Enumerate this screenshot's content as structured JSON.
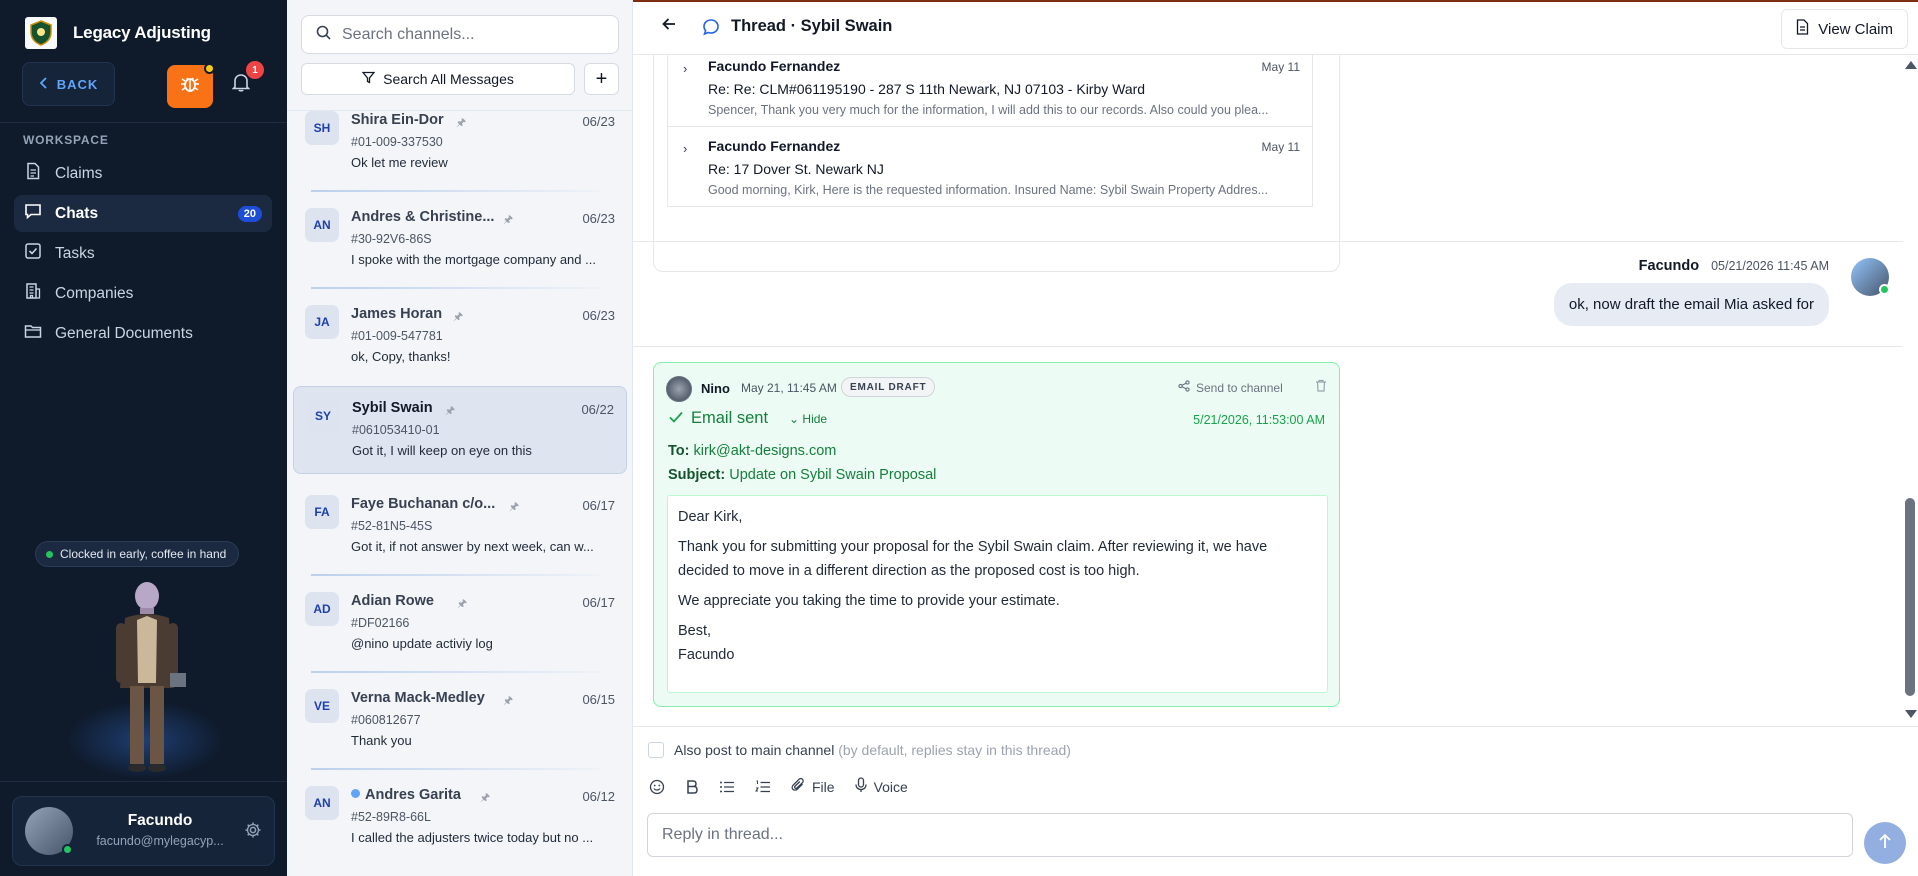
{
  "app": {
    "title": "Legacy Adjusting"
  },
  "sidebar": {
    "back_label": "BACK",
    "notification_count": "1",
    "section_label": "WORKSPACE",
    "items": [
      {
        "label": "Claims",
        "icon": "document-icon"
      },
      {
        "label": "Chats",
        "icon": "chat-icon",
        "badge": "20",
        "active": true
      },
      {
        "label": "Tasks",
        "icon": "checkbox-icon"
      },
      {
        "label": "Companies",
        "icon": "building-icon"
      },
      {
        "label": "General Documents",
        "icon": "folder-icon"
      }
    ],
    "status_text": "Clocked in early, coffee in hand",
    "user": {
      "name": "Facundo",
      "email": "facundo@mylegacyp..."
    }
  },
  "channels": {
    "search_placeholder": "Search channels...",
    "search_all_label": "Search All Messages",
    "add_label": "+",
    "list": [
      {
        "initials": "SH",
        "name": "Shira Ein-Dor",
        "date": "06/23",
        "code": "#01-009-337530",
        "last": "Ok let me review"
      },
      {
        "initials": "AN",
        "name": "Andres & Christine...",
        "date": "06/23",
        "code": "#30-92V6-86S",
        "last": "I spoke with the mortgage company and ..."
      },
      {
        "initials": "JA",
        "name": "James Horan",
        "date": "06/23",
        "code": "#01-009-547781",
        "last": "ok, Copy, thanks!"
      },
      {
        "initials": "SY",
        "name": "Sybil Swain",
        "date": "06/22",
        "code": "#061053410-01",
        "last": "Got it, I will keep on eye on this",
        "selected": true
      },
      {
        "initials": "FA",
        "name": "Faye Buchanan c/o...",
        "date": "06/17",
        "code": "#52-81N5-45S",
        "last": "Got it, if not answer by next week, can w..."
      },
      {
        "initials": "AD",
        "name": "Adian Rowe",
        "date": "06/17",
        "code": "#DF02166",
        "last": "@nino update activiy log"
      },
      {
        "initials": "VE",
        "name": "Verna Mack-Medley",
        "date": "06/15",
        "code": "#060812677",
        "last": "Thank you"
      },
      {
        "initials": "AN",
        "name": "Andres Garita",
        "date": "06/12",
        "code": "#52-89R8-66L",
        "last": "I called the adjusters twice today but no ...",
        "unread": true
      }
    ]
  },
  "thread": {
    "title": "Thread · Sybil Swain",
    "view_claim_label": "View Claim",
    "emails": [
      {
        "from": "Facundo Fernandez",
        "date": "May 11",
        "subject": "Re: Re: CLM#061195190 - 287 S 11th Newark, NJ 07103 - Kirby Ward",
        "preview": "Spencer, Thank you very much for the information, I will add this to our records. Also could you plea..."
      },
      {
        "from": "Facundo Fernandez",
        "date": "May 11",
        "subject": "Re: 17 Dover St. Newark NJ",
        "preview": "Good morning, Kirk, Here is the requested information. Insured Name: Sybil Swain Property Addres..."
      }
    ],
    "my_message": {
      "name": "Facundo",
      "time": "05/21/2026 11:45 AM",
      "text": "ok, now draft the email Mia asked for"
    },
    "draft": {
      "author": "Nino",
      "time": "May 21, 11:45 AM",
      "tag": "EMAIL DRAFT",
      "send_label": "Send to channel",
      "status": "Email sent",
      "hide_label": "Hide",
      "sent_time": "5/21/2026, 11:53:00 AM",
      "to_label": "To:",
      "to": "kirk@akt-designs.com",
      "subject_label": "Subject:",
      "subject": "Update on Sybil Swain Proposal",
      "body": {
        "greeting": "Dear Kirk,",
        "p1": "Thank you for submitting your proposal for the Sybil Swain claim. After reviewing it, we have decided to move in a different direction as the proposed cost is too high.",
        "p2": "We appreciate you taking the time to provide your estimate.",
        "signoff": "Best,",
        "signature": "Facundo"
      }
    }
  },
  "composer": {
    "also_post_label": "Also post to main channel",
    "also_post_hint": "(by default, replies stay in this thread)",
    "file_label": "File",
    "voice_label": "Voice",
    "placeholder": "Reply in thread..."
  },
  "colors": {
    "sidebar_bg": "#0f1a2b",
    "accent_orange": "#f97316",
    "success_green": "#15803d",
    "badge_blue": "#1d4ed8"
  }
}
